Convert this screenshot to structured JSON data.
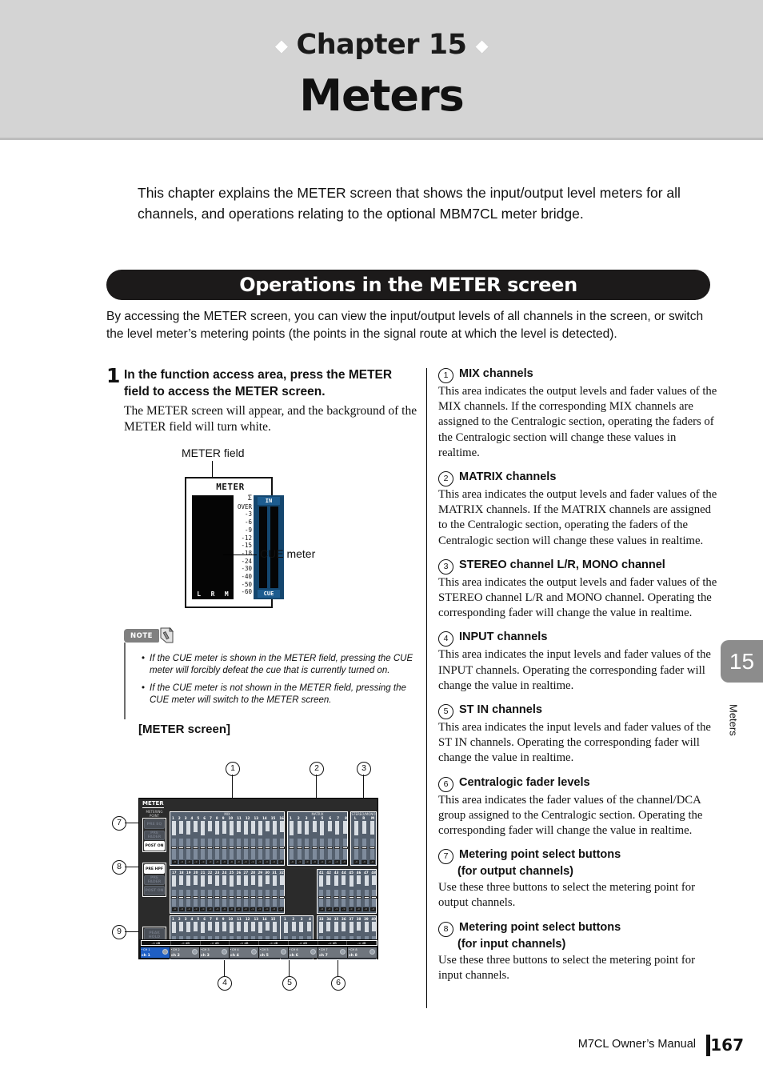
{
  "chapter": {
    "eyebrow": "Chapter 15",
    "title": "Meters",
    "diamond": "◆"
  },
  "intro": "This chapter explains the METER screen that shows the input/output level meters for all channels, and operations relating to the optional MBM7CL meter bridge.",
  "section": {
    "banner": "Operations in the METER screen",
    "lead": "By accessing the METER screen, you can view the input/output levels of all channels in the screen, or switch the level meter’s metering points (the points in the signal route at which the level is detected)."
  },
  "step": {
    "number": "1",
    "heading": "In the function access area, press the METER field to access the METER screen.",
    "body": "The METER screen will appear, and the background of the METER field will turn white."
  },
  "meter_field": {
    "caption": "METER field",
    "title": "METER",
    "cue_label": "CUE meter",
    "scale": [
      "Σ",
      "OVER",
      "-3",
      "-6",
      "-9",
      "-12",
      "-15",
      "-18",
      "-24",
      "-30",
      "-40",
      "-50",
      "-60"
    ],
    "lrm": [
      "L",
      "R",
      "M"
    ],
    "in_label": "IN",
    "cue_button": "CUE"
  },
  "note": {
    "badge": "NOTE",
    "items": [
      "If the CUE meter is shown in the METER field, pressing the CUE meter will forcibly defeat the cue that is currently turned on.",
      "If the CUE meter is not shown in the METER field, pressing the CUE meter will switch to the METER screen."
    ]
  },
  "meter_screen": {
    "figure_title": "[METER screen]",
    "screen_title": "METER",
    "metering_point_label": "METERING POINT",
    "output_buttons": [
      "PRE EQ",
      "PRE FADER",
      "POST ON"
    ],
    "output_selected": "POST ON",
    "input_buttons": [
      "PRE HPF",
      "PRE FADER",
      "POST ON"
    ],
    "input_selected": "PRE HPF",
    "peak_hold_button": "PEAK HOLD",
    "sections": {
      "mix": "MIX",
      "matrix": "MATRIX",
      "stereo_mono": "STEREO/MONO"
    },
    "mix_channels": [
      "1",
      "2",
      "3",
      "4",
      "5",
      "6",
      "7",
      "8",
      "9",
      "10",
      "11",
      "12",
      "13",
      "14",
      "15",
      "16"
    ],
    "matrix_channels": [
      "1",
      "2",
      "3",
      "4",
      "5",
      "6",
      "7",
      "8"
    ],
    "stereo_channels": [
      "L",
      "R",
      "M"
    ],
    "input_row1": [
      "17",
      "18",
      "19",
      "20",
      "21",
      "22",
      "23",
      "24",
      "25",
      "26",
      "27",
      "28",
      "29",
      "30",
      "31",
      "32"
    ],
    "input_row2": [
      "1",
      "2",
      "3",
      "4",
      "5",
      "6",
      "7",
      "8",
      "9",
      "10",
      "11",
      "12",
      "13",
      "14",
      "15",
      "16"
    ],
    "stin_channels": [
      "1",
      "2",
      "3",
      "4"
    ],
    "dca_row1": [
      "41",
      "42",
      "43",
      "44",
      "45",
      "46",
      "47",
      "48"
    ],
    "dca_row2": [
      "33",
      "34",
      "35",
      "36",
      "37",
      "38",
      "39",
      "40"
    ],
    "fader_value": "-∞",
    "scale_marks": [
      "10",
      "0",
      "10",
      "20",
      "∞"
    ],
    "db_unit": "dB",
    "strip_channels": [
      {
        "top": "CH 1",
        "name": "ch 1",
        "selected": true
      },
      {
        "top": "CH 2",
        "name": "ch 2",
        "selected": false
      },
      {
        "top": "CH 3",
        "name": "ch 3",
        "selected": false
      },
      {
        "top": "CH 4",
        "name": "ch 4",
        "selected": false
      },
      {
        "top": "CH 5",
        "name": "ch 5",
        "selected": false
      },
      {
        "top": "CH 6",
        "name": "ch 6",
        "selected": false
      },
      {
        "top": "CH 7",
        "name": "ch 7",
        "selected": false
      },
      {
        "top": "CH 8",
        "name": "ch 8",
        "selected": false
      }
    ],
    "callouts": [
      "1",
      "2",
      "3",
      "4",
      "5",
      "6",
      "7",
      "8",
      "9"
    ]
  },
  "descriptions": [
    {
      "num": "①",
      "title": "MIX channels",
      "body": "This area indicates the output levels and fader values of the MIX channels. If the corresponding MIX channels are assigned to the Centralogic section, operating the faders of the Centralogic section will change these values in realtime."
    },
    {
      "num": "②",
      "title": "MATRIX channels",
      "body": "This area indicates the output levels and fader values of the MATRIX channels. If the MATRIX channels are assigned to the Centralogic section, operating the faders of the Centralogic section will change these values in realtime."
    },
    {
      "num": "③",
      "title": "STEREO channel L/R, MONO channel",
      "body": "This area indicates the output levels and fader values of the STEREO channel L/R and MONO channel. Operating the corresponding fader will change the value in realtime."
    },
    {
      "num": "④",
      "title": "INPUT channels",
      "body": "This area indicates the input levels and fader values of the INPUT channels. Operating the corresponding fader will change the value in realtime."
    },
    {
      "num": "⑤",
      "title": "ST IN channels",
      "body": "This area indicates the input levels and fader values of the ST IN channels. Operating the corresponding fader will change the value in realtime."
    },
    {
      "num": "⑥",
      "title": "Centralogic fader levels",
      "body": "This area indicates the fader values of the channel/DCA group assigned to the Centralogic section. Operating the corresponding fader will change the value in realtime."
    },
    {
      "num": "⑦",
      "title": "Metering point select buttons",
      "subtitle": "(for output channels)",
      "body": "Use these three buttons to select the metering point for output channels."
    },
    {
      "num": "⑧",
      "title": "Metering point select buttons",
      "subtitle": "(for input channels)",
      "body": "Use these three buttons to select the metering point for input channels."
    }
  ],
  "side_tab": {
    "number": "15",
    "label": "Meters"
  },
  "footer": {
    "manual": "M7CL  Owner’s Manual",
    "page": "167"
  }
}
